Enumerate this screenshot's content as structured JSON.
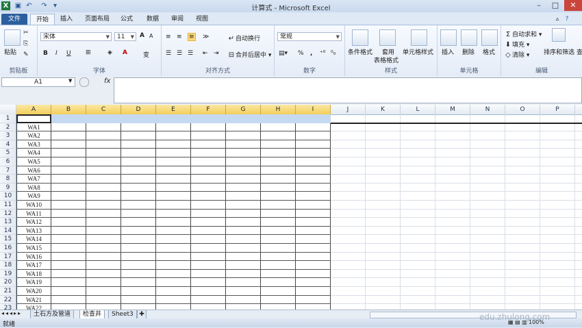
{
  "window": {
    "title": "计算式 - Microsoft Excel",
    "quick_access": [
      "save-icon",
      "undo-icon",
      "redo-icon"
    ]
  },
  "ribbon_tabs": [
    "文件",
    "开始",
    "插入",
    "页面布局",
    "公式",
    "数据",
    "审阅",
    "视图"
  ],
  "active_tab": "开始",
  "ribbon": {
    "clipboard": {
      "label": "剪贴板",
      "paste": "粘贴"
    },
    "font": {
      "label": "字体",
      "font_name": "宋体",
      "font_size": "11",
      "bold": "B",
      "italic": "I",
      "underline": "U",
      "grow": "A",
      "shrink": "A",
      "phonetic": "变"
    },
    "alignment": {
      "label": "对齐方式",
      "wrap": "自动换行",
      "merge": "合并后居中"
    },
    "number": {
      "label": "数字",
      "format": "常规",
      "percent": "%",
      "comma": ","
    },
    "styles": {
      "label": "样式",
      "cond": "条件格式",
      "table_line1": "套用",
      "table_line2": "表格格式",
      "cell": "单元格样式"
    },
    "cells": {
      "label": "单元格",
      "insert": "插入",
      "delete": "删除",
      "format": "格式"
    },
    "editing": {
      "label": "编辑",
      "autosum": "自动求和",
      "fill": "填充",
      "clear": "清除",
      "sort": "排序和筛选",
      "find": "查"
    }
  },
  "formula_bar": {
    "name_box": "A1",
    "fx": "fx",
    "content": ""
  },
  "columns": [
    "A",
    "B",
    "C",
    "D",
    "E",
    "F",
    "G",
    "H",
    "I",
    "J",
    "K",
    "L",
    "M",
    "N",
    "O",
    "P"
  ],
  "rows": [
    {
      "n": "1",
      "a": ""
    },
    {
      "n": "2",
      "a": "WA1"
    },
    {
      "n": "3",
      "a": "WA2"
    },
    {
      "n": "4",
      "a": "WA3"
    },
    {
      "n": "5",
      "a": "WA4"
    },
    {
      "n": "6",
      "a": "WA5"
    },
    {
      "n": "7",
      "a": "WA6"
    },
    {
      "n": "8",
      "a": "WA7"
    },
    {
      "n": "9",
      "a": "WA8"
    },
    {
      "n": "10",
      "a": "WA9"
    },
    {
      "n": "11",
      "a": "WA10"
    },
    {
      "n": "12",
      "a": "WA11"
    },
    {
      "n": "13",
      "a": "WA12"
    },
    {
      "n": "14",
      "a": "WA13"
    },
    {
      "n": "15",
      "a": "WA14"
    },
    {
      "n": "16",
      "a": "WA15"
    },
    {
      "n": "17",
      "a": "WA16"
    },
    {
      "n": "18",
      "a": "WA17"
    },
    {
      "n": "19",
      "a": "WA18"
    },
    {
      "n": "20",
      "a": "WA19"
    },
    {
      "n": "21",
      "a": "WA20"
    },
    {
      "n": "22",
      "a": "WA21"
    },
    {
      "n": "23",
      "a": "WA22"
    }
  ],
  "sheet_tabs": [
    "土石方及管道",
    "检查井",
    "Sheet3"
  ],
  "active_sheet": "检查井",
  "status": {
    "ready": "就绪",
    "zoom": "100%",
    "watermark": "edu.zhulong.com"
  }
}
